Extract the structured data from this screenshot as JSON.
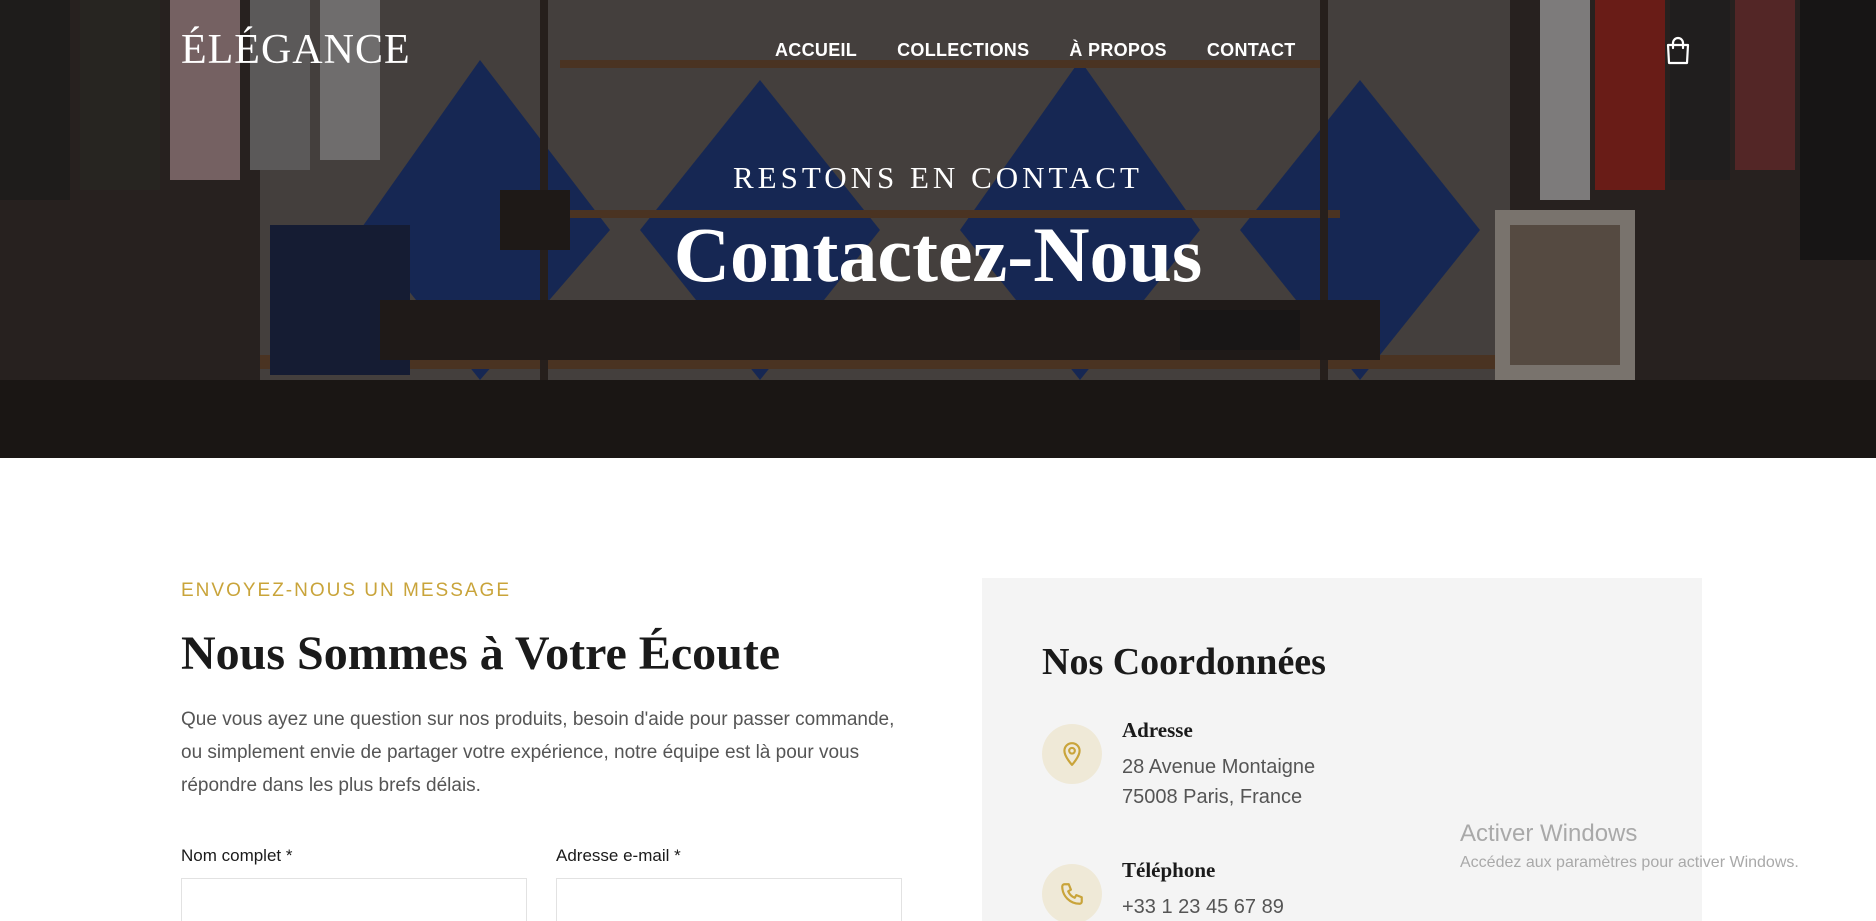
{
  "brand": {
    "logo": "ÉLÉGANCE"
  },
  "nav": {
    "items": [
      {
        "label": "ACCUEIL"
      },
      {
        "label": "COLLECTIONS"
      },
      {
        "label": "À PROPOS"
      },
      {
        "label": "CONTACT"
      }
    ],
    "cart_icon": "shopping-bag-icon"
  },
  "hero": {
    "eyebrow": "RESTONS EN CONTACT",
    "title": "Contactez-Nous"
  },
  "message_section": {
    "eyebrow": "ENVOYEZ-NOUS UN MESSAGE",
    "heading": "Nous Sommes à Votre Écoute",
    "intro": "Que vous ayez une question sur nos produits, besoin d'aide pour passer commande, ou simplement envie de partager votre expérience, notre équipe est là pour vous répondre dans les plus brefs délais.",
    "form": {
      "name_label": "Nom complet *",
      "name_value": "",
      "email_label": "Adresse e-mail *",
      "email_value": ""
    }
  },
  "contact_card": {
    "title": "Nos Coordonnées",
    "address": {
      "icon": "map-pin-icon",
      "label": "Adresse",
      "line1": "28 Avenue Montaigne",
      "line2": "75008 Paris, France"
    },
    "phone": {
      "icon": "phone-icon",
      "label": "Téléphone",
      "line1": "+33 1 23 45 67 89"
    }
  },
  "os_watermark": {
    "title": "Activer Windows",
    "subtitle": "Accédez aux paramètres pour activer Windows."
  },
  "colors": {
    "accent": "#c9a43a",
    "card_bg": "#f4f4f4",
    "icon_bg": "#efe9d7",
    "text_dark": "#1a1a1a",
    "text_muted": "#555555"
  }
}
